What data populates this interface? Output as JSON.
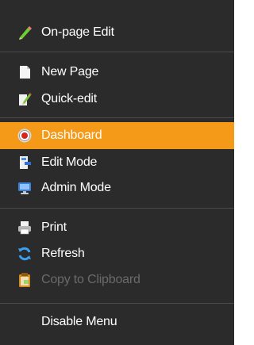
{
  "menu": {
    "items": [
      {
        "label": "On-page Edit",
        "icon": "pencil-icon"
      },
      {
        "label": "New Page",
        "icon": "new-page-icon"
      },
      {
        "label": "Quick-edit",
        "icon": "quick-edit-icon"
      },
      {
        "label": "Dashboard",
        "icon": "dashboard-icon",
        "selected": true
      },
      {
        "label": "Edit Mode",
        "icon": "edit-mode-icon"
      },
      {
        "label": "Admin Mode",
        "icon": "admin-mode-icon"
      },
      {
        "label": "Print",
        "icon": "printer-icon"
      },
      {
        "label": "Refresh",
        "icon": "refresh-icon"
      },
      {
        "label": "Copy to Clipboard",
        "icon": "clipboard-icon",
        "disabled": true
      },
      {
        "label": "Disable Menu",
        "icon": ""
      }
    ]
  },
  "colors": {
    "background": "#2b2b2b",
    "highlight": "#f49a18",
    "text": "#ffffff",
    "disabled_text": "#6a6a6a",
    "separator": "#4a4a4a"
  }
}
